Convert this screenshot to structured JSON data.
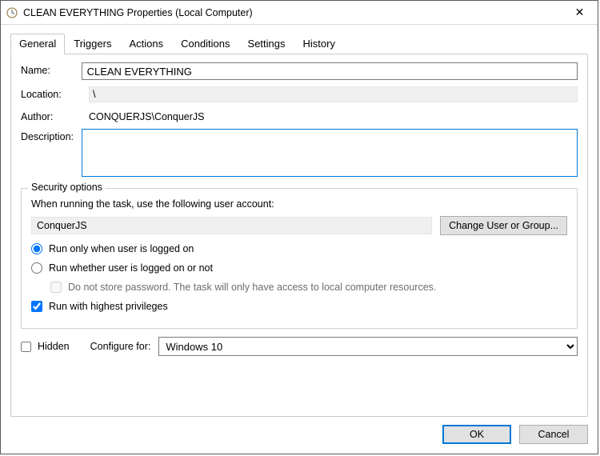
{
  "window": {
    "title": "CLEAN EVERYTHING Properties (Local Computer)",
    "close_glyph": "✕"
  },
  "tabs": [
    {
      "label": "General",
      "active": true
    },
    {
      "label": "Triggers"
    },
    {
      "label": "Actions"
    },
    {
      "label": "Conditions"
    },
    {
      "label": "Settings"
    },
    {
      "label": "History"
    }
  ],
  "general": {
    "name_label": "Name:",
    "name_value": "CLEAN EVERYTHING",
    "location_label": "Location:",
    "location_value": "\\",
    "author_label": "Author:",
    "author_value": "CONQUERJS\\ConquerJS",
    "description_label": "Description:",
    "description_value": ""
  },
  "security": {
    "legend": "Security options",
    "prompt": "When running the task, use the following user account:",
    "user": "ConquerJS",
    "change_user_btn": "Change User or Group...",
    "radio_logged_on": "Run only when user is logged on",
    "radio_logged_on_or_not": "Run whether user is logged on or not",
    "no_store_password": "Do not store password.  The task will only have access to local computer resources.",
    "highest_priv": "Run with highest privileges",
    "radio_selected": "logged_on",
    "no_store_password_checked": false,
    "highest_priv_checked": true
  },
  "footer": {
    "hidden_label": "Hidden",
    "hidden_checked": false,
    "configure_label": "Configure for:",
    "configure_value": "Windows 10",
    "configure_options": [
      "Windows 10"
    ]
  },
  "dialog": {
    "ok": "OK",
    "cancel": "Cancel"
  }
}
